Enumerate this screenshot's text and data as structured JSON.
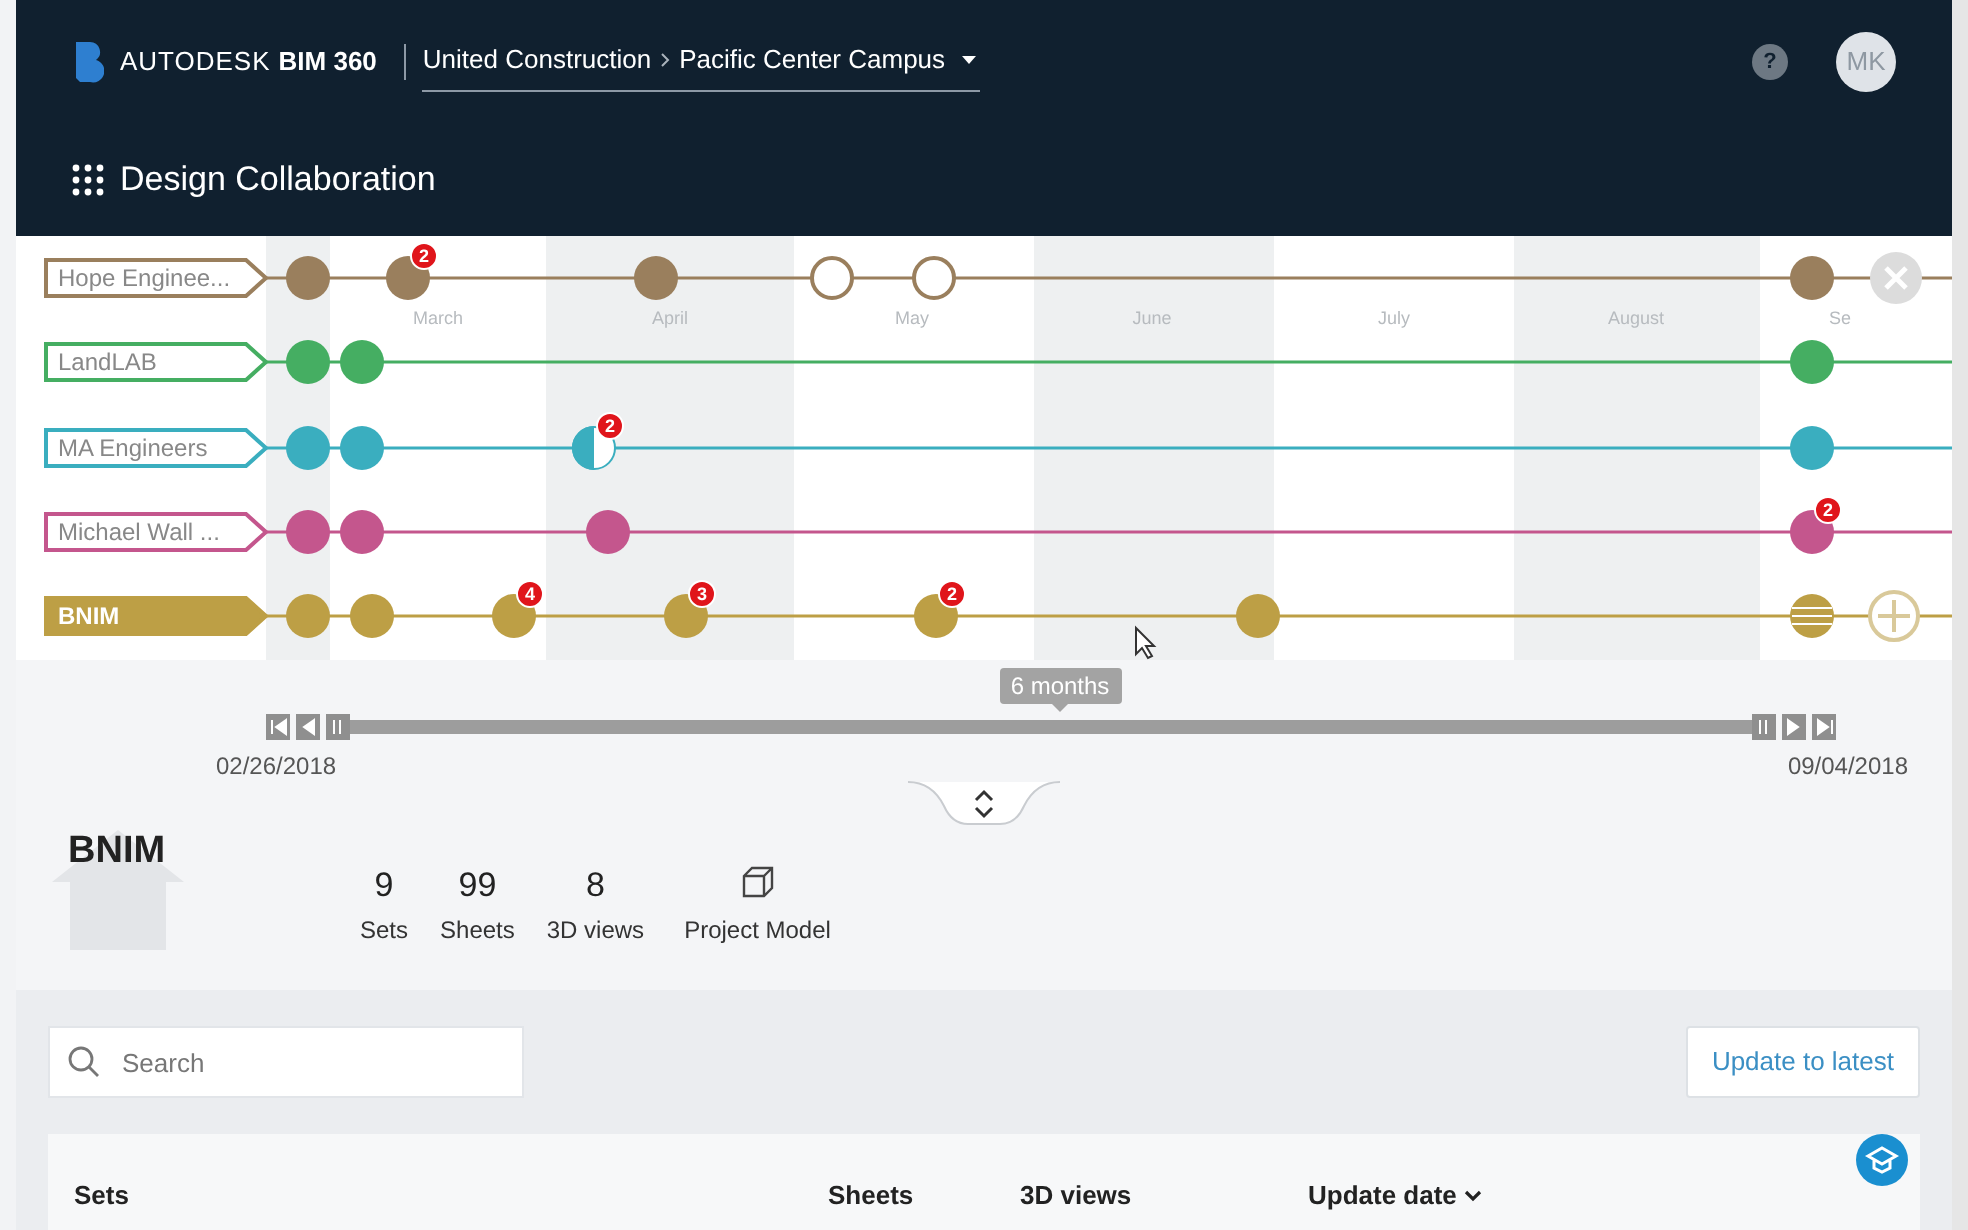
{
  "header": {
    "brand": "AUTODESK",
    "product": "BIM 360",
    "breadcrumb": [
      {
        "label": "United Construction"
      },
      {
        "label": "Pacific Center Campus"
      }
    ],
    "help": "?",
    "avatar": "MK"
  },
  "module": {
    "title": "Design Collaboration"
  },
  "timeline": {
    "months": [
      "March",
      "April",
      "May",
      "June",
      "July",
      "August",
      "Se"
    ],
    "teams": [
      {
        "name": "Hope Enginee...",
        "color": "#9a7f5d",
        "selected": false,
        "markers": [
          {
            "kind": "filled"
          },
          {
            "kind": "filled",
            "badge": "2"
          },
          {
            "kind": "filled"
          },
          {
            "kind": "hollow"
          },
          {
            "kind": "hollow"
          },
          {
            "kind": "filled"
          }
        ]
      },
      {
        "name": "LandLAB",
        "color": "#45ae62",
        "selected": false,
        "markers": [
          {
            "kind": "filled"
          },
          {
            "kind": "filled"
          },
          {
            "kind": "filled"
          }
        ]
      },
      {
        "name": "MA Engineers",
        "color": "#3aaebf",
        "selected": false,
        "markers": [
          {
            "kind": "filled"
          },
          {
            "kind": "filled"
          },
          {
            "kind": "half",
            "badge": "2"
          },
          {
            "kind": "filled"
          }
        ]
      },
      {
        "name": "Michael Wall ...",
        "color": "#c4568d",
        "selected": false,
        "markers": [
          {
            "kind": "filled"
          },
          {
            "kind": "filled"
          },
          {
            "kind": "filled"
          },
          {
            "kind": "filled",
            "badge": "2"
          }
        ]
      },
      {
        "name": "BNIM",
        "color": "#bd9f45",
        "selected": true,
        "markers": [
          {
            "kind": "filled"
          },
          {
            "kind": "filled"
          },
          {
            "kind": "filled",
            "badge": "4"
          },
          {
            "kind": "filled",
            "badge": "3"
          },
          {
            "kind": "filled",
            "badge": "2"
          },
          {
            "kind": "filled"
          },
          {
            "kind": "striped"
          }
        ]
      }
    ]
  },
  "range": {
    "span": "6 months",
    "start": "02/26/2018",
    "end": "09/04/2018"
  },
  "package": {
    "name": "BNIM",
    "stats": [
      {
        "value": "9",
        "label": "Sets"
      },
      {
        "value": "99",
        "label": "Sheets"
      },
      {
        "value": "8",
        "label": "3D views"
      }
    ],
    "model": "Project Model"
  },
  "search": {
    "placeholder": "Search"
  },
  "update_button": "Update to latest",
  "table": {
    "columns": [
      {
        "label": "Sets",
        "sorted": false
      },
      {
        "label": "Sheets",
        "sorted": false
      },
      {
        "label": "3D views",
        "sorted": false
      },
      {
        "label": "Update date",
        "sorted": true
      }
    ]
  }
}
